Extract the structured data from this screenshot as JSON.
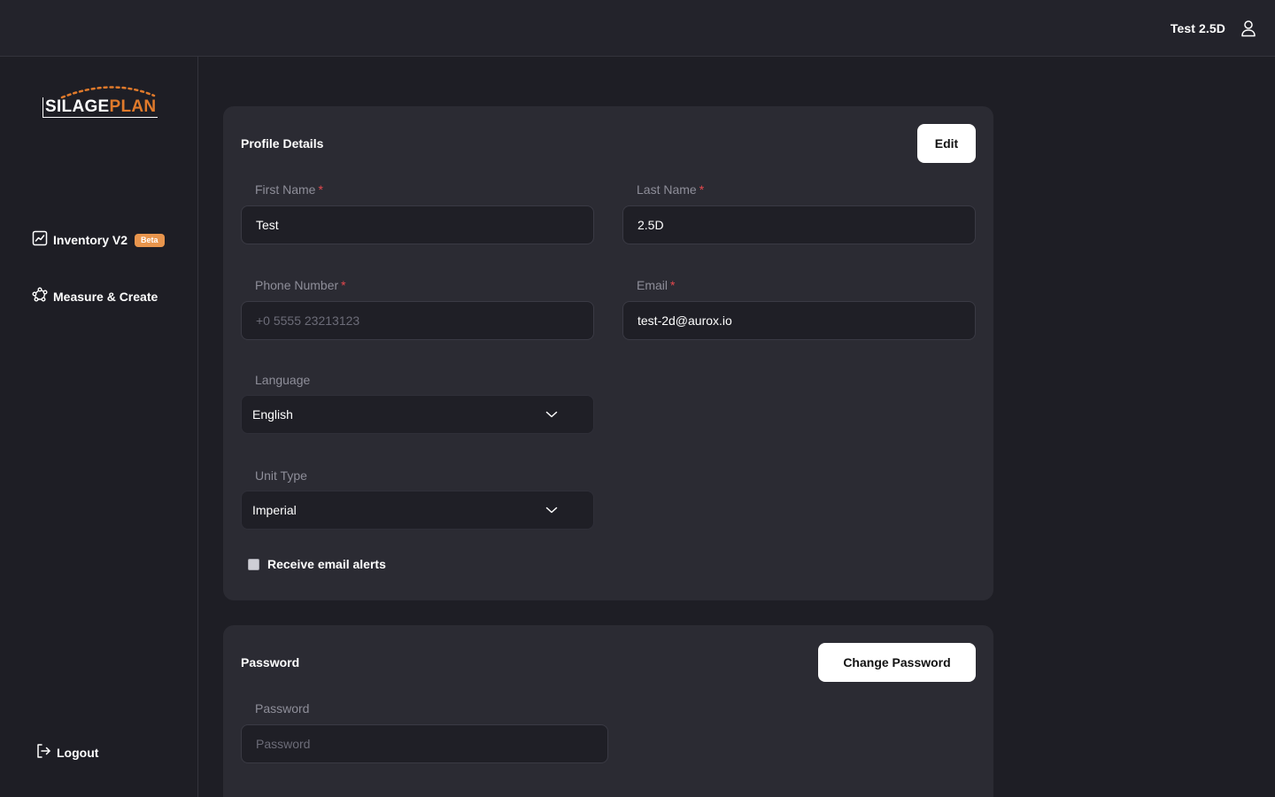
{
  "header": {
    "user_name": "Test 2.5D",
    "user_icon": "user-icon"
  },
  "sidebar": {
    "logo_part1": "SILAGE",
    "logo_part2": "PLAN",
    "items": [
      {
        "label": "Inventory V2",
        "badge": "Beta",
        "icon": "chart-icon"
      },
      {
        "label": "Measure & Create",
        "icon": "measure-icon"
      }
    ],
    "logout_label": "Logout"
  },
  "profile": {
    "title": "Profile Details",
    "edit_label": "Edit",
    "first_name": {
      "label": "First Name",
      "required": "*",
      "value": "Test"
    },
    "last_name": {
      "label": "Last Name",
      "required": "*",
      "value": "2.5D"
    },
    "phone": {
      "label": "Phone Number",
      "required": "*",
      "placeholder": "+0 5555 23213123"
    },
    "email": {
      "label": "Email",
      "required": "*",
      "value": "test-2d@aurox.io"
    },
    "language": {
      "label": "Language",
      "value": "English"
    },
    "unit_type": {
      "label": "Unit Type",
      "value": "Imperial"
    },
    "email_alerts": {
      "label": "Receive email alerts",
      "checked": false
    }
  },
  "password_section": {
    "title": "Password",
    "change_label": "Change Password",
    "field_label": "Password",
    "placeholder": "Password"
  },
  "colors": {
    "accent": "#e07a2b",
    "badge": "#e8954d",
    "required": "#e5484d",
    "background": "#1e1e25",
    "card": "#2b2b33"
  }
}
